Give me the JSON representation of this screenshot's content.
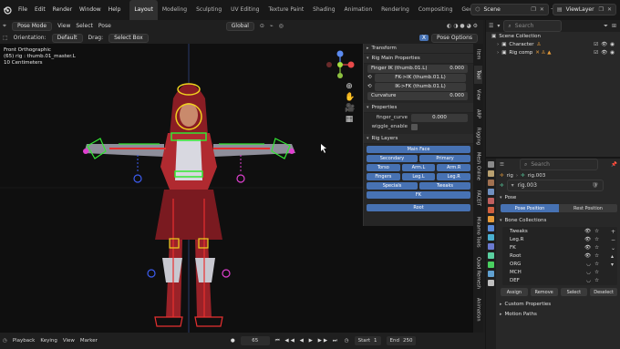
{
  "topbar": {
    "menus": [
      "File",
      "Edit",
      "Render",
      "Window",
      "Help"
    ],
    "workspaces": [
      "Layout",
      "Modeling",
      "Sculpting",
      "UV Editing",
      "Texture Paint",
      "Shading",
      "Animation",
      "Rendering",
      "Compositing",
      "Geometry Nodes",
      "Scripting"
    ],
    "active_workspace": "Layout",
    "scene_label": "Scene",
    "viewlayer_label": "ViewLayer"
  },
  "viewport_header": {
    "mode": "Pose Mode",
    "menus": [
      "View",
      "Select",
      "Pose"
    ],
    "transform_orientation": "Global",
    "orientation_label": "Orientation:",
    "orientation_value": "Default",
    "drag_label": "Drag:",
    "drag_value": "Select Box",
    "pose_options": "Pose Options"
  },
  "viewport": {
    "view_name": "Front Orthographic",
    "active_info": "(65) rig : thumb.01_master.L",
    "scale": "10 Centimeters"
  },
  "npanel": {
    "transform_title": "Transform",
    "rig_main_title": "Rig Main Properties",
    "finger_ik_label": "Finger IK (thumb.01.L)",
    "finger_ik_value": "0.000",
    "fk_to_ik": "FK->IK (thumb.01.L)",
    "ik_to_fk": "IK->FK (thumb.01.L)",
    "curvature_label": "Curvature",
    "curvature_value": "0.000",
    "properties_title": "Properties",
    "finger_curve_label": "finger_curve",
    "finger_curve_value": "0.000",
    "wiggle_label": "wiggle_enable",
    "rig_layers_title": "Rig Layers",
    "layers": {
      "main_face": "Main Face",
      "secondary": "Secondary",
      "primary": "Primary",
      "torso": "Torso",
      "arm_l": "Arm.L",
      "arm_r": "Arm.R",
      "fingers": "Fingers",
      "leg_l": "Leg.L",
      "leg_r": "Leg.R",
      "specials": "Specials",
      "tweaks": "Tweaks",
      "fk": "FK",
      "root": "Root"
    }
  },
  "vtabs": [
    "Item",
    "Tool",
    "View",
    "ARP",
    "Rigging",
    "Mesh Online",
    "FACEIT",
    "Mixamo Tools",
    "Quad Remesh",
    "Animation"
  ],
  "outliner": {
    "search_placeholder": "Search",
    "scene_collection": "Scene Collection",
    "items": [
      "Character",
      "Rig comp"
    ]
  },
  "properties": {
    "search_placeholder": "Search",
    "breadcrumb_obj": "rig",
    "breadcrumb_data": "rig.003",
    "data_name": "rig.003",
    "pose_title": "Pose",
    "pose_position": "Pose Position",
    "rest_position": "Rest Position",
    "bone_collections_title": "Bone Collections",
    "collections": [
      "Tweaks",
      "Leg.R",
      "FK",
      "Root",
      "ORG",
      "MCH",
      "DEF"
    ],
    "assign": "Assign",
    "remove": "Remove",
    "select": "Select",
    "deselect": "Deselect",
    "custom_properties": "Custom Properties",
    "motion_paths": "Motion Paths"
  },
  "timeline": {
    "menus": [
      "Playback",
      "Keying",
      "View",
      "Marker"
    ],
    "current_frame": "65",
    "start_label": "Start",
    "start_value": "1",
    "end_label": "End",
    "end_value": "250"
  },
  "colors": {
    "accent": "#4772b3",
    "bone_green": "#33e833",
    "bone_yellow": "#f0d21e",
    "bone_red": "#e83030",
    "bone_blue": "#3c5cf0",
    "bone_magenta": "#e040d0"
  }
}
